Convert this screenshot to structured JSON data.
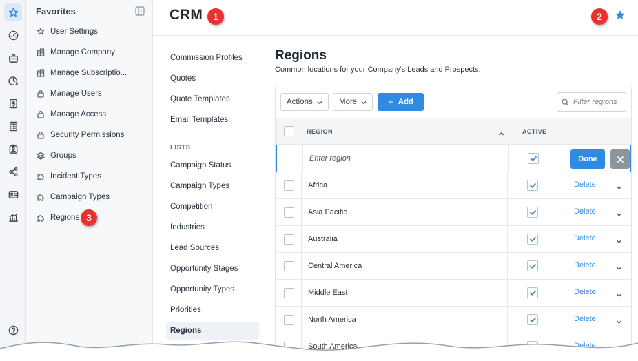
{
  "rail": {
    "icons": [
      "star-icon",
      "dashboard-icon",
      "briefcase-icon",
      "clock-dollar-icon",
      "dollar-doc-icon",
      "calculator-icon",
      "id-badge-icon",
      "share-icon",
      "contact-card-icon",
      "analytics-icon",
      "help-icon"
    ]
  },
  "favorites": {
    "title": "Favorites",
    "items": [
      {
        "label": "User Settings",
        "icon": "star-outline-icon"
      },
      {
        "label": "Manage Company",
        "icon": "building-icon"
      },
      {
        "label": "Manage Subscriptio...",
        "icon": "building-icon"
      },
      {
        "label": "Manage Users",
        "icon": "lock-icon"
      },
      {
        "label": "Manage Access",
        "icon": "lock-icon"
      },
      {
        "label": "Security Permissions",
        "icon": "lock-icon"
      },
      {
        "label": "Groups",
        "icon": "layers-icon"
      },
      {
        "label": "Incident Types",
        "icon": "puzzle-icon"
      },
      {
        "label": "Campaign Types",
        "icon": "puzzle-icon"
      },
      {
        "label": "Regions",
        "icon": "puzzle-icon"
      }
    ]
  },
  "header": {
    "title": "CRM"
  },
  "callouts": [
    "1",
    "2",
    "3"
  ],
  "settings_nav": {
    "top_items": [
      "Commission Profiles",
      "Quotes",
      "Quote Templates",
      "Email Templates"
    ],
    "section_heading": "LISTS",
    "list_items": [
      "Campaign Status",
      "Campaign Types",
      "Competition",
      "Industries",
      "Lead Sources",
      "Opportunity Stages",
      "Opportunity Types",
      "Priorities",
      "Regions"
    ],
    "active": "Regions"
  },
  "content": {
    "title": "Regions",
    "subtitle": "Common locations for your Company's Leads and Prospects."
  },
  "toolbar": {
    "actions_label": "Actions",
    "more_label": "More",
    "add_label": "Add",
    "filter_placeholder": "Filter regions"
  },
  "table": {
    "columns": [
      "REGION",
      "ACTIVE"
    ],
    "sort": "ascending",
    "edit_row": {
      "placeholder": "Enter region",
      "active": true,
      "done_label": "Done"
    },
    "rows": [
      {
        "region": "Africa",
        "active": true
      },
      {
        "region": "Asia Pacific",
        "active": true
      },
      {
        "region": "Australia",
        "active": true
      },
      {
        "region": "Central America",
        "active": true
      },
      {
        "region": "Middle East",
        "active": true
      },
      {
        "region": "North America",
        "active": true
      },
      {
        "region": "South America",
        "active": true
      }
    ],
    "delete_label": "Delete"
  },
  "colors": {
    "accent": "#2f8ae6",
    "callout": "#e8322f"
  }
}
